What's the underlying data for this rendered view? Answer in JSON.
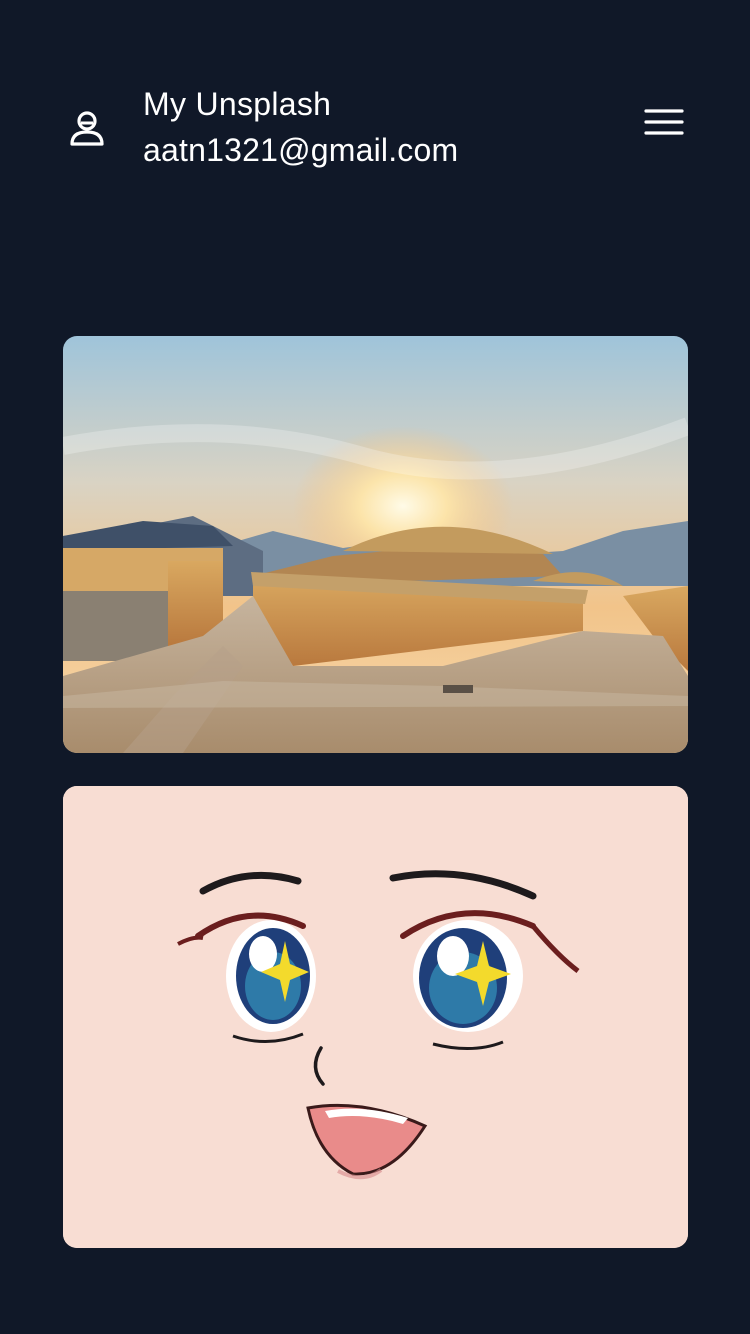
{
  "header": {
    "app_title": "My Unsplash",
    "user_email": "aatn1321@gmail.com",
    "user_icon": "user-icon",
    "menu_icon": "hamburger-menu-icon"
  },
  "gallery": {
    "photos": [
      {
        "subject": "village-sunset"
      },
      {
        "subject": "anime-face"
      }
    ]
  },
  "colors": {
    "background": "#101828",
    "text": "#ffffff",
    "face_bg": "#f8ddd3"
  }
}
